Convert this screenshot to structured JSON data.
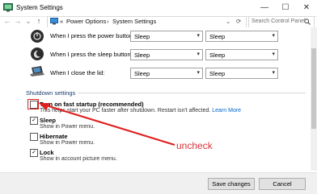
{
  "window": {
    "title": "System Settings",
    "minimize": "—",
    "maximize": "☐",
    "close": "✕"
  },
  "nav": {
    "back": "←",
    "forward": "→",
    "dropdown": "⌄",
    "up": "↑",
    "sep": "«",
    "crumbs": [
      "Power Options",
      "System Settings"
    ],
    "crumb_sep": "›",
    "refresh": "⟳",
    "addr_dropdown": "⌄"
  },
  "search": {
    "placeholder": "Search Control Panel"
  },
  "power_rows": [
    {
      "label": "When I press the power button:",
      "battery": "Sleep",
      "plugged": "Sleep",
      "icon": "power-button-icon"
    },
    {
      "label": "When I press the sleep button:",
      "battery": "Sleep",
      "plugged": "Sleep",
      "icon": "sleep-button-icon"
    },
    {
      "label": "When I close the lid:",
      "battery": "Sleep",
      "plugged": "Sleep",
      "icon": "laptop-lid-icon"
    }
  ],
  "shutdown": {
    "title": "Shutdown settings",
    "fast_startup": {
      "label": "Turn on fast startup (recommended)",
      "desc": "This helps start your PC faster after shutdown. Restart isn't affected.",
      "link": "Learn More",
      "checked": false
    },
    "sleep": {
      "label": "Sleep",
      "desc": "Show in Power menu.",
      "checked": true
    },
    "hibernate": {
      "label": "Hibernate",
      "desc": "Show in Power menu.",
      "checked": false
    },
    "lock": {
      "label": "Lock",
      "desc": "Show in account picture menu.",
      "checked": true
    }
  },
  "annotation": {
    "text": "uncheck",
    "color": "#d9333a"
  },
  "footer": {
    "save": "Save changes",
    "cancel": "Cancel"
  }
}
